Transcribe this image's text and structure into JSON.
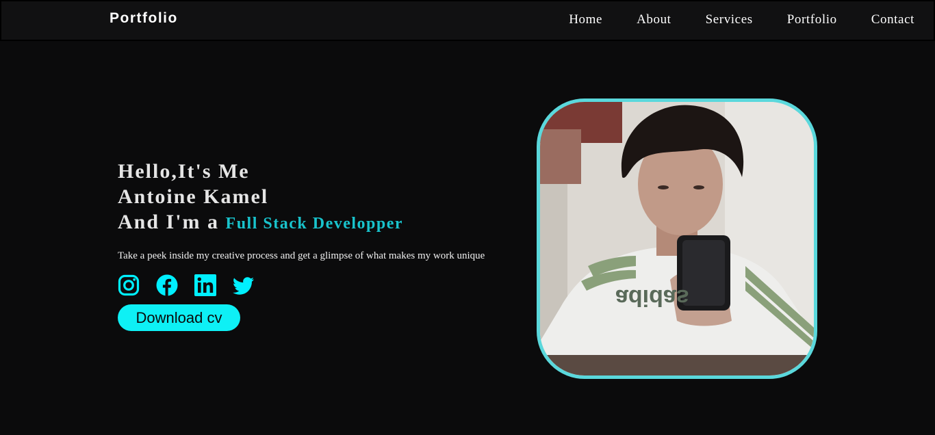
{
  "navbar": {
    "logo": "Portfolio",
    "links": [
      {
        "label": "Home"
      },
      {
        "label": "About"
      },
      {
        "label": "Services"
      },
      {
        "label": "Portfolio"
      },
      {
        "label": "Contact"
      }
    ]
  },
  "hero": {
    "greeting": "Hello,It's Me",
    "name": "Antoine Kamel",
    "role_prefix": "And I'm a",
    "role": "Full Stack Developper",
    "tagline": "Take a peek inside my creative process and get a glimpse of what makes my work unique",
    "socials": [
      {
        "icon": "instagram-icon"
      },
      {
        "icon": "facebook-icon"
      },
      {
        "icon": "linkedin-icon"
      },
      {
        "icon": "twitter-icon"
      }
    ],
    "cv_button": "Download cv"
  },
  "colors": {
    "background": "#0b0b0c",
    "navbar": "#111112",
    "accent": "#19c3cc",
    "icon": "#00f0ff",
    "button": "#0ef0f5",
    "frame_border": "#5ad8dc"
  }
}
